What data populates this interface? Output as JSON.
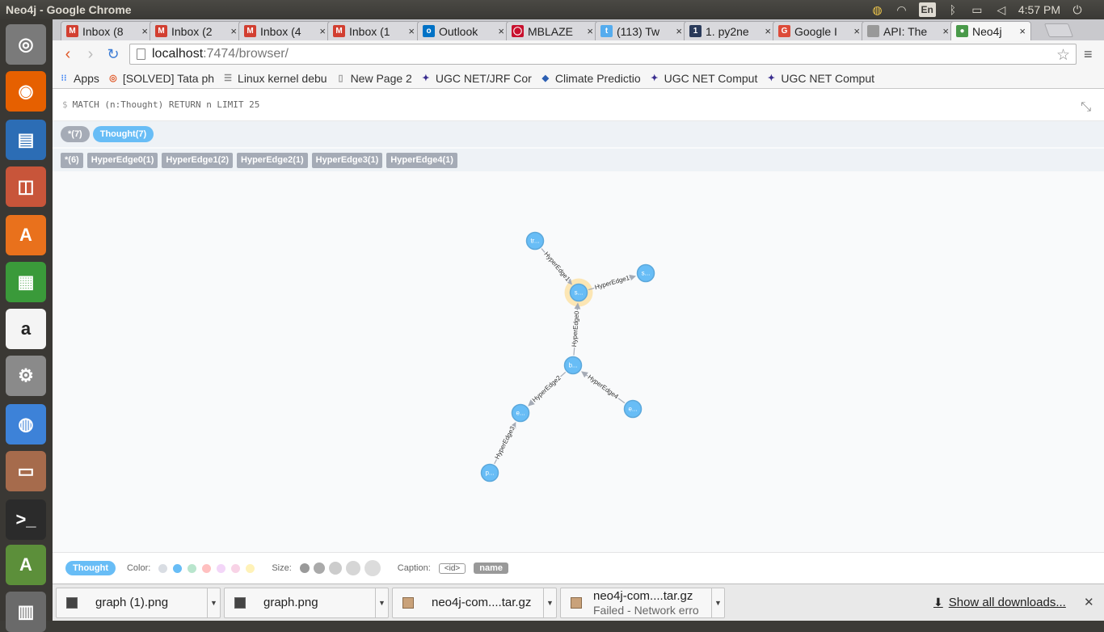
{
  "window": {
    "title": "Neo4j - Google Chrome"
  },
  "indicators": {
    "keyboard": "En",
    "time": "4:57 PM"
  },
  "launcher": {
    "items": [
      {
        "name": "dash-home",
        "glyph": "◎",
        "color": "#7a7a7a"
      },
      {
        "name": "firefox",
        "glyph": "◉",
        "color": "#e66000"
      },
      {
        "name": "writer",
        "glyph": "▤",
        "color": "#2c6db5"
      },
      {
        "name": "impress",
        "glyph": "◫",
        "color": "#c8553a"
      },
      {
        "name": "software-center",
        "glyph": "A",
        "color": "#e9711c"
      },
      {
        "name": "calc",
        "glyph": "▦",
        "color": "#3a9a3a"
      },
      {
        "name": "amazon",
        "glyph": "a",
        "color": "#f4f4f4"
      },
      {
        "name": "system-settings",
        "glyph": "⚙",
        "color": "#8a8a8a"
      },
      {
        "name": "chrome",
        "glyph": "◍",
        "color": "#3d82d8"
      },
      {
        "name": "files",
        "glyph": "▭",
        "color": "#a66b4c"
      },
      {
        "name": "terminal",
        "glyph": ">_",
        "color": "#2b2b2b"
      },
      {
        "name": "software-updater",
        "glyph": "A",
        "color": "#5c8f3a"
      },
      {
        "name": "trash",
        "glyph": "▥",
        "color": "#6a6a6a"
      }
    ]
  },
  "tabs": [
    {
      "label": "Inbox (8",
      "favicon": "gmail",
      "color": "#d23f31",
      "letter": "M"
    },
    {
      "label": "Inbox (2",
      "favicon": "gmail",
      "color": "#d23f31",
      "letter": "M"
    },
    {
      "label": "Inbox (4",
      "favicon": "gmail",
      "color": "#d23f31",
      "letter": "M"
    },
    {
      "label": "Inbox (1",
      "favicon": "gmail",
      "color": "#d23f31",
      "letter": "M"
    },
    {
      "label": "Outlook",
      "favicon": "outlook",
      "color": "#0072c6",
      "letter": "o"
    },
    {
      "label": "MBLAZE",
      "favicon": "mblaze",
      "color": "#c8102e",
      "letter": "◯"
    },
    {
      "label": "(113) Tw",
      "favicon": "twitter",
      "color": "#55acee",
      "letter": "t"
    },
    {
      "label": "1. py2ne",
      "favicon": "py2neo",
      "color": "#2a3a5a",
      "letter": "1"
    },
    {
      "label": "Google I",
      "favicon": "google",
      "color": "#dd4b39",
      "letter": "G"
    },
    {
      "label": "API: The",
      "favicon": "page",
      "color": "#999999",
      "letter": ""
    },
    {
      "label": "Neo4j",
      "favicon": "neo4j",
      "color": "#4a9a4a",
      "letter": "●",
      "active": true
    }
  ],
  "toolbar": {
    "url_host": "localhost",
    "url_path": ":7474/browser/"
  },
  "bookmarks": [
    {
      "label": "Apps",
      "icon": "apps-icon",
      "color": "#4285f4",
      "glyph": "⁝⁝"
    },
    {
      "label": "[SOLVED] Tata ph",
      "icon": "ubuntu-icon",
      "color": "#e05a2a",
      "glyph": "◎"
    },
    {
      "label": "Linux kernel debu",
      "icon": "list-icon",
      "color": "#888888",
      "glyph": "☰"
    },
    {
      "label": "New Page 2",
      "icon": "page-icon",
      "color": "#999999",
      "glyph": "▯"
    },
    {
      "label": "UGC NET/JRF Cor",
      "icon": "ugc-icon",
      "color": "#3a2e8f",
      "glyph": "✦"
    },
    {
      "label": "Climate Predictio",
      "icon": "climate-icon",
      "color": "#2c5fb3",
      "glyph": "◆"
    },
    {
      "label": "UGC NET Comput",
      "icon": "ugc-icon",
      "color": "#3a2e8f",
      "glyph": "✦"
    },
    {
      "label": "UGC NET Comput",
      "icon": "ugc-icon",
      "color": "#3a2e8f",
      "glyph": "✦"
    }
  ],
  "query": {
    "prompt": "$",
    "text": "MATCH (n:Thought) RETURN n LIMIT 25"
  },
  "labels": [
    {
      "text": "*(7)",
      "style": "gray"
    },
    {
      "text": "Thought(7)",
      "style": "blue"
    }
  ],
  "relationships": [
    {
      "text": "*(6)"
    },
    {
      "text": "HyperEdge0(1)"
    },
    {
      "text": "HyperEdge1(2)"
    },
    {
      "text": "HyperEdge2(1)"
    },
    {
      "text": "HyperEdge3(1)"
    },
    {
      "text": "HyperEdge4(1)"
    }
  ],
  "graph": {
    "node_color": "#68bdf6",
    "node_stroke": "#5ca8db",
    "selected_halo": "#fce6b4",
    "nodes": [
      {
        "id": "n1",
        "caption": "tr..."
      },
      {
        "id": "n2",
        "caption": "s...",
        "selected": true
      },
      {
        "id": "n3",
        "caption": "s..."
      },
      {
        "id": "n4",
        "caption": "b..."
      },
      {
        "id": "n5",
        "caption": "e..."
      },
      {
        "id": "n6",
        "caption": "e..."
      },
      {
        "id": "n7",
        "caption": "p..."
      }
    ],
    "edges": [
      {
        "from": "n1",
        "to": "n2",
        "label": "HyperEdge1"
      },
      {
        "from": "n2",
        "to": "n3",
        "label": "HyperEdge1"
      },
      {
        "from": "n4",
        "to": "n2",
        "label": "HyperEdge0"
      },
      {
        "from": "n4",
        "to": "n5",
        "label": "HyperEdge2"
      },
      {
        "from": "n6",
        "to": "n4",
        "label": "HyperEdge4"
      },
      {
        "from": "n7",
        "to": "n5",
        "label": "HyperEdge3"
      }
    ]
  },
  "legend": {
    "label": "Thought",
    "color_title": "Color:",
    "colors": [
      "#d9dde3",
      "#68bdf6",
      "#b9e5cd",
      "#ffc0c0",
      "#f3d6f8",
      "#f8d3e6",
      "#fff2b8"
    ],
    "size_title": "Size:",
    "sizes": [
      "smallest",
      "small",
      "medium",
      "large",
      "largest"
    ],
    "caption_title": "Caption:",
    "caption_id": "<id>",
    "caption_name": "name"
  },
  "downloads": {
    "items": [
      {
        "name": "graph (1).png",
        "kind": "image",
        "status": ""
      },
      {
        "name": "graph.png",
        "kind": "image",
        "status": ""
      },
      {
        "name": "neo4j-com....tar.gz",
        "kind": "archive",
        "status": ""
      },
      {
        "name": "neo4j-com....tar.gz",
        "kind": "archive",
        "status": "Failed - Network erro"
      }
    ],
    "show_all": "Show all downloads..."
  }
}
